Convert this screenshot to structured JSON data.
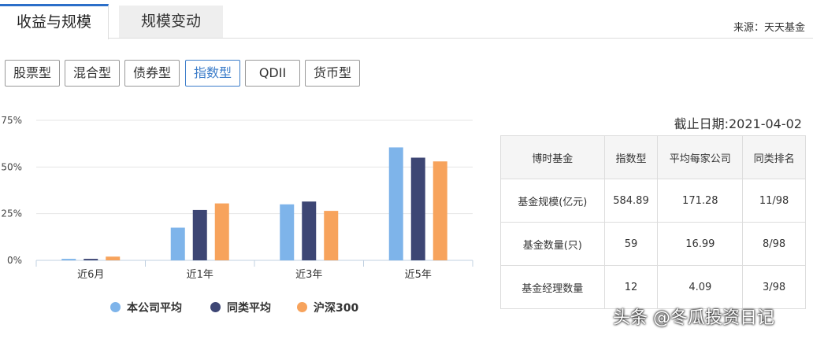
{
  "tabs": {
    "active": "收益与规模",
    "inactive": "规模变动"
  },
  "source": "来源：天天基金",
  "fund_types": [
    "股票型",
    "混合型",
    "债券型",
    "指数型",
    "QDII",
    "货币型"
  ],
  "active_type": "指数型",
  "colors": {
    "series_1": "#7eb4ea",
    "series_2": "#3d4674",
    "series_3": "#f7a35c",
    "accent": "#3b7cc9"
  },
  "chart_data": {
    "type": "bar",
    "categories": [
      "近6月",
      "近1年",
      "近3年",
      "近5年"
    ],
    "series": [
      {
        "name": "本公司平均",
        "values": [
          0.8,
          17.5,
          30,
          60.5
        ]
      },
      {
        "name": "同类平均",
        "values": [
          0.8,
          27,
          31.5,
          55
        ]
      },
      {
        "name": "沪深300",
        "values": [
          2,
          30.5,
          26.5,
          53
        ]
      }
    ],
    "yticks": [
      "0%",
      "25%",
      "50%",
      "75%"
    ],
    "ylim": [
      0,
      75
    ],
    "legend": "bottom",
    "grid": true
  },
  "date_label": "截止日期:2021-04-02",
  "table": {
    "header": [
      "博时基金",
      "指数型",
      "平均每家公司",
      "同类排名"
    ],
    "rows": [
      [
        "基金规模(亿元)",
        "584.89",
        "171.28",
        "11/98"
      ],
      [
        "基金数量(只)",
        "59",
        "16.99",
        "8/98"
      ],
      [
        "基金经理数量",
        "12",
        "4.09",
        "3/98"
      ]
    ]
  },
  "watermark": "头条 @冬瓜投资日记"
}
